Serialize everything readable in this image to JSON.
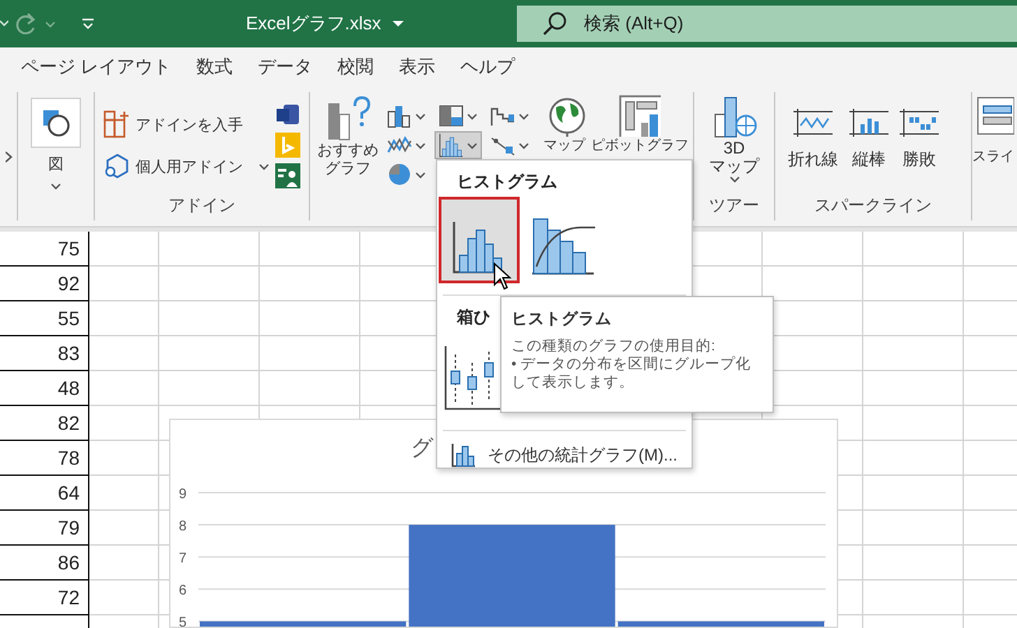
{
  "title_bar": {
    "filename": "Excelグラフ.xlsx",
    "search_placeholder": "検索 (Alt+Q)"
  },
  "tabs": [
    {
      "label": "ページ レイアウト",
      "selected": false
    },
    {
      "label": "数式",
      "selected": false
    },
    {
      "label": "データ",
      "selected": false
    },
    {
      "label": "校閲",
      "selected": false
    },
    {
      "label": "表示",
      "selected": false
    },
    {
      "label": "ヘルプ",
      "selected": false
    }
  ],
  "ribbon": [
    {
      "kind": "illustrations",
      "buttons": [
        {
          "label": "図"
        }
      ]
    },
    {
      "kind": "addins",
      "label": "アドイン",
      "buttons": [
        {
          "label": "アドインを入手"
        },
        {
          "label": "個人用アドイン"
        }
      ]
    },
    {
      "kind": "charts",
      "recommended": [
        "おすすめ",
        "グラフ"
      ],
      "small_buttons": [
        {
          "expanded": false
        },
        {
          "expanded": false
        },
        {
          "expanded": false
        },
        {
          "expanded": false
        },
        {
          "expanded": true
        },
        {
          "expanded": false
        },
        {
          "expanded": false
        }
      ],
      "buttons": [
        {
          "label": "マップ"
        },
        {
          "label": "ピボットグラフ"
        }
      ]
    },
    {
      "kind": "tour",
      "label": "ツアー",
      "buttons": [
        {
          "label": "3D\nマップ"
        }
      ]
    },
    {
      "kind": "sparklines",
      "label": "スパークライン",
      "buttons": [
        {
          "label": "折れ線"
        },
        {
          "label": "縦棒"
        },
        {
          "label": "勝敗"
        }
      ]
    },
    {
      "kind": "filters",
      "buttons": [
        {
          "label": "スライ"
        }
      ]
    }
  ],
  "sheet": {
    "column_1": [
      "75",
      "92",
      "55",
      "83",
      "48",
      "82",
      "78",
      "64",
      "79",
      "86",
      "72"
    ]
  },
  "chart": {
    "title": "グ",
    "chart_data": {
      "type": "bar",
      "values": [
        5,
        8,
        5
      ],
      "ylim": [
        4.75,
        9
      ],
      "yticks": [
        5,
        6,
        7,
        8,
        9
      ],
      "grid": true
    }
  },
  "dropdown": {
    "sections": [
      {
        "heading": "ヒストグラム",
        "gallery": [
          {
            "selected": true
          },
          {
            "selected": false
          }
        ]
      },
      {
        "heading": "箱ひ",
        "gallery": [
          {
            "selected": false
          }
        ]
      }
    ],
    "more_item": "その他の統計グラフ(M)..."
  },
  "tooltip": {
    "title": "ヒストグラム",
    "description": "この種類のグラフの使用目的:",
    "bullet": "• データの分布を区間にグループ化して表示します。"
  }
}
